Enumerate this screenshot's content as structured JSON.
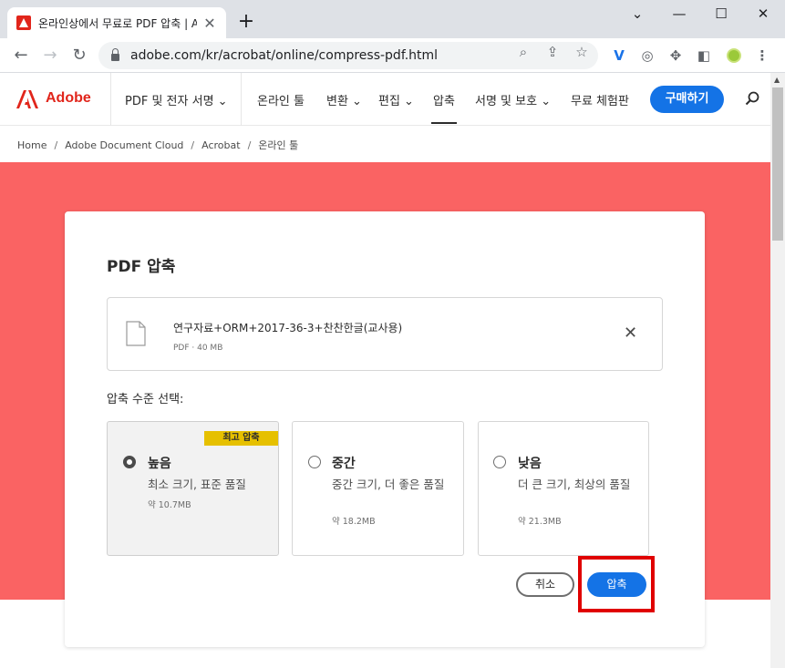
{
  "browser": {
    "tab_title": "온라인상에서 무료로 PDF 압축 | Adobe",
    "tab_close": "✕",
    "new_tab": "+",
    "url": "adobe.com/kr/acrobat/online/compress-pdf.html",
    "window_controls": {
      "dropdown": "⌄",
      "minimize": "—",
      "maximize": "☐",
      "close": "✕"
    }
  },
  "header": {
    "logo_text": "Adobe",
    "nav": {
      "pdf_esign": "PDF 및 전자 서명 ⌄",
      "online_tools": "온라인 툴",
      "convert": "변환 ⌄",
      "edit": "편집 ⌄",
      "compress": "압축",
      "sign_protect": "서명 및 보호 ⌄",
      "free_trial": "무료 체험판"
    },
    "buy_label": "구매하기"
  },
  "breadcrumb": [
    "Home",
    "Adobe Document Cloud",
    "Acrobat",
    "온라인 툴"
  ],
  "dialog": {
    "title": "PDF 압축",
    "file": {
      "name": "연구자료+ORM+2017-36-3+찬찬한글(교사용)",
      "meta": "PDF · 40 MB",
      "remove": "✕"
    },
    "level_label": "압축 수준 선택:",
    "options": [
      {
        "badge": "최고 압축",
        "title": "높음",
        "desc": "최소 크기, 표준 품질",
        "size": "약 10.7MB",
        "selected": true
      },
      {
        "title": "중간",
        "desc": "중간 크기, 더 좋은 품질",
        "size": "약 18.2MB",
        "selected": false
      },
      {
        "title": "낮음",
        "desc": "더 큰 크기, 최상의 품질",
        "size": "약 21.3MB",
        "selected": false
      }
    ],
    "cancel_label": "취소",
    "compress_label": "압축"
  },
  "colors": {
    "hero": "#fa6363",
    "accent": "#1473e6",
    "adobe_red": "#e1251b",
    "badge": "#e6c000",
    "highlight": "#e00000"
  }
}
